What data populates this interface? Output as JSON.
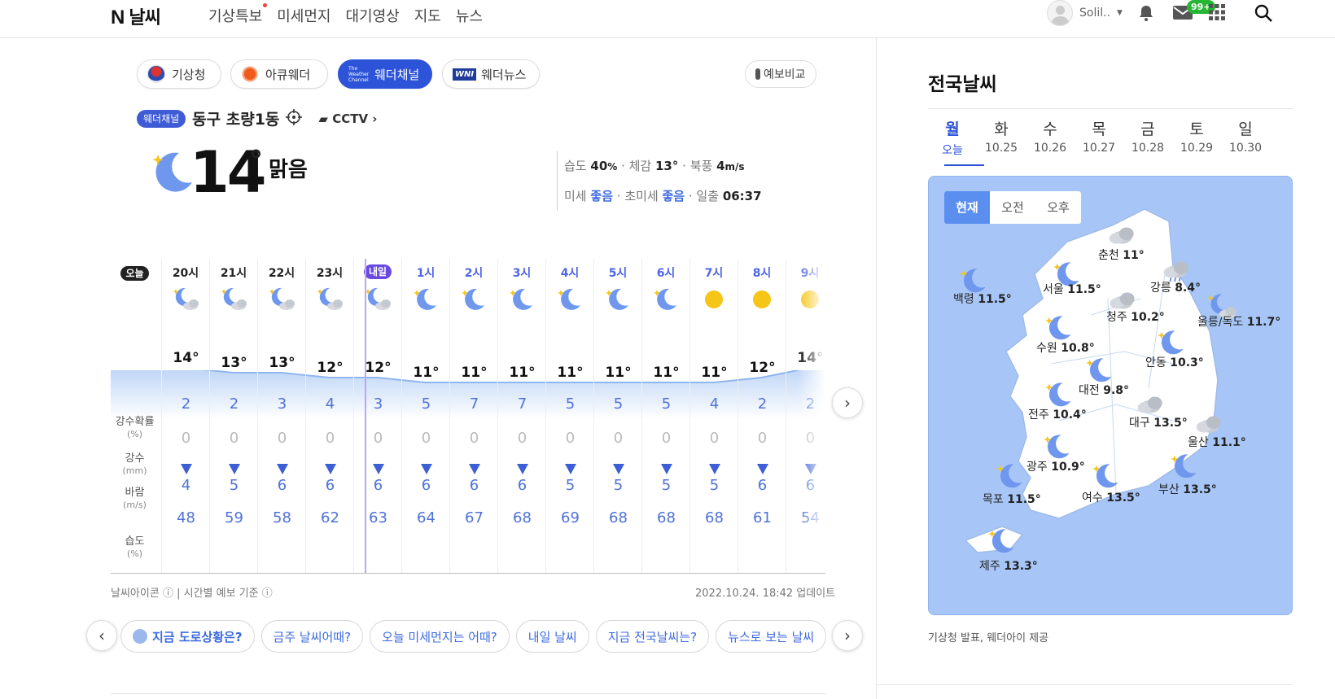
{
  "header": {
    "logo_n": "N",
    "logo_text": "날씨",
    "nav": [
      "기상특보",
      "미세먼지",
      "대기영상",
      "지도",
      "뉴스"
    ],
    "user_name": "Solil..",
    "mail_badge": "99+"
  },
  "providers": {
    "items": [
      "기상청",
      "아큐웨더",
      "웨더채널",
      "웨더뉴스"
    ],
    "selected": "웨더채널",
    "compare": "예보비교"
  },
  "location": {
    "badge": "웨더채널",
    "name": "동구 초량1동",
    "cctv": "CCTV"
  },
  "current": {
    "temp": "14",
    "deg": "°",
    "condition": "맑음",
    "humidity_label": "습도",
    "humidity": "40",
    "humidity_unit": "%",
    "feel_label": "체감",
    "feel": "13°",
    "wind_dir": "북풍",
    "wind": "4",
    "wind_unit": "m/s",
    "dust_label": "미세",
    "dust": "좋음",
    "fine_dust_label": "초미세",
    "fine_dust": "좋음",
    "sunrise_label": "일출",
    "sunrise": "06:37"
  },
  "hourly": {
    "today_badge": "오늘",
    "tomorrow_badge": "내일",
    "hours": [
      "20시",
      "21시",
      "22시",
      "23시",
      "내일",
      "1시",
      "2시",
      "3시",
      "4시",
      "5시",
      "6시",
      "7시",
      "8시",
      "9시"
    ],
    "icons": [
      "moon-cloud",
      "moon-cloud",
      "moon-cloud",
      "moon-cloud",
      "moon-cloud",
      "moon",
      "moon",
      "moon",
      "moon",
      "moon",
      "moon",
      "sun",
      "sun",
      "sun"
    ],
    "temps": [
      "14°",
      "13°",
      "13°",
      "12°",
      "12°",
      "11°",
      "11°",
      "11°",
      "11°",
      "11°",
      "11°",
      "11°",
      "12°",
      "14°"
    ],
    "temp_values": [
      14,
      13,
      13,
      12,
      12,
      11,
      11,
      11,
      11,
      11,
      11,
      11,
      12,
      14
    ],
    "precip_prob_label": "강수확률",
    "precip_prob_unit": "(%)",
    "precip_prob": [
      "2",
      "2",
      "3",
      "4",
      "3",
      "5",
      "7",
      "7",
      "5",
      "5",
      "5",
      "4",
      "2",
      "2"
    ],
    "precip_label": "강수",
    "precip_unit": "(mm)",
    "precip": [
      "0",
      "0",
      "0",
      "0",
      "0",
      "0",
      "0",
      "0",
      "0",
      "0",
      "0",
      "0",
      "0",
      "0"
    ],
    "wind_label": "바람",
    "wind_unit": "(m/s)",
    "wind": [
      "4",
      "5",
      "6",
      "6",
      "6",
      "6",
      "6",
      "6",
      "5",
      "5",
      "5",
      "5",
      "6",
      "6"
    ],
    "humidity_label": "습도",
    "humidity_unit": "(%)",
    "humidity": [
      "48",
      "59",
      "58",
      "62",
      "63",
      "64",
      "67",
      "68",
      "69",
      "68",
      "68",
      "68",
      "61",
      "54"
    ]
  },
  "footer": {
    "icon_info": "날씨아이콘",
    "basis": "시간별 예보 기준",
    "updated": "2022.10.24. 18:42 업데이트"
  },
  "chips": [
    "지금 도로상황은?",
    "금주 날씨어때?",
    "오늘 미세먼지는 어때?",
    "내일 날씨",
    "지금 전국날씨는?",
    "뉴스로 보는 날씨"
  ],
  "national": {
    "title": "전국날씨",
    "days": [
      {
        "d": "월",
        "dt": "오늘"
      },
      {
        "d": "화",
        "dt": "10.25"
      },
      {
        "d": "수",
        "dt": "10.26"
      },
      {
        "d": "목",
        "dt": "10.27"
      },
      {
        "d": "금",
        "dt": "10.28"
      },
      {
        "d": "토",
        "dt": "10.29"
      },
      {
        "d": "일",
        "dt": "10.30"
      }
    ],
    "tabs": [
      "현재",
      "오전",
      "오후"
    ],
    "cities": [
      {
        "name": "춘천",
        "temp": "11°",
        "icon": "cloud"
      },
      {
        "name": "백령",
        "temp": "11.5°",
        "icon": "moon"
      },
      {
        "name": "서울",
        "temp": "11.5°",
        "icon": "moon"
      },
      {
        "name": "강릉",
        "temp": "8.4°",
        "icon": "rain"
      },
      {
        "name": "청주",
        "temp": "10.2°",
        "icon": "cloud"
      },
      {
        "name": "울릉/독도",
        "temp": "11.7°",
        "icon": "moon-cloud"
      },
      {
        "name": "수원",
        "temp": "10.8°",
        "icon": "moon"
      },
      {
        "name": "안동",
        "temp": "10.3°",
        "icon": "moon"
      },
      {
        "name": "대전",
        "temp": "9.8°",
        "icon": "moon"
      },
      {
        "name": "전주",
        "temp": "10.4°",
        "icon": "moon"
      },
      {
        "name": "대구",
        "temp": "13.5°",
        "icon": "cloud"
      },
      {
        "name": "울산",
        "temp": "11.1°",
        "icon": "cloud"
      },
      {
        "name": "광주",
        "temp": "10.9°",
        "icon": "moon"
      },
      {
        "name": "목포",
        "temp": "11.5°",
        "icon": "moon"
      },
      {
        "name": "여수",
        "temp": "13.5°",
        "icon": "moon"
      },
      {
        "name": "부산",
        "temp": "13.5°",
        "icon": "moon"
      },
      {
        "name": "제주",
        "temp": "13.3°",
        "icon": "moon"
      }
    ],
    "credit": "기상청 발표, 웨더아이 제공"
  },
  "colors": {
    "accent": "#2d53d8",
    "value_blue": "#4f72d9",
    "map_bg": "#a7c6f7"
  }
}
